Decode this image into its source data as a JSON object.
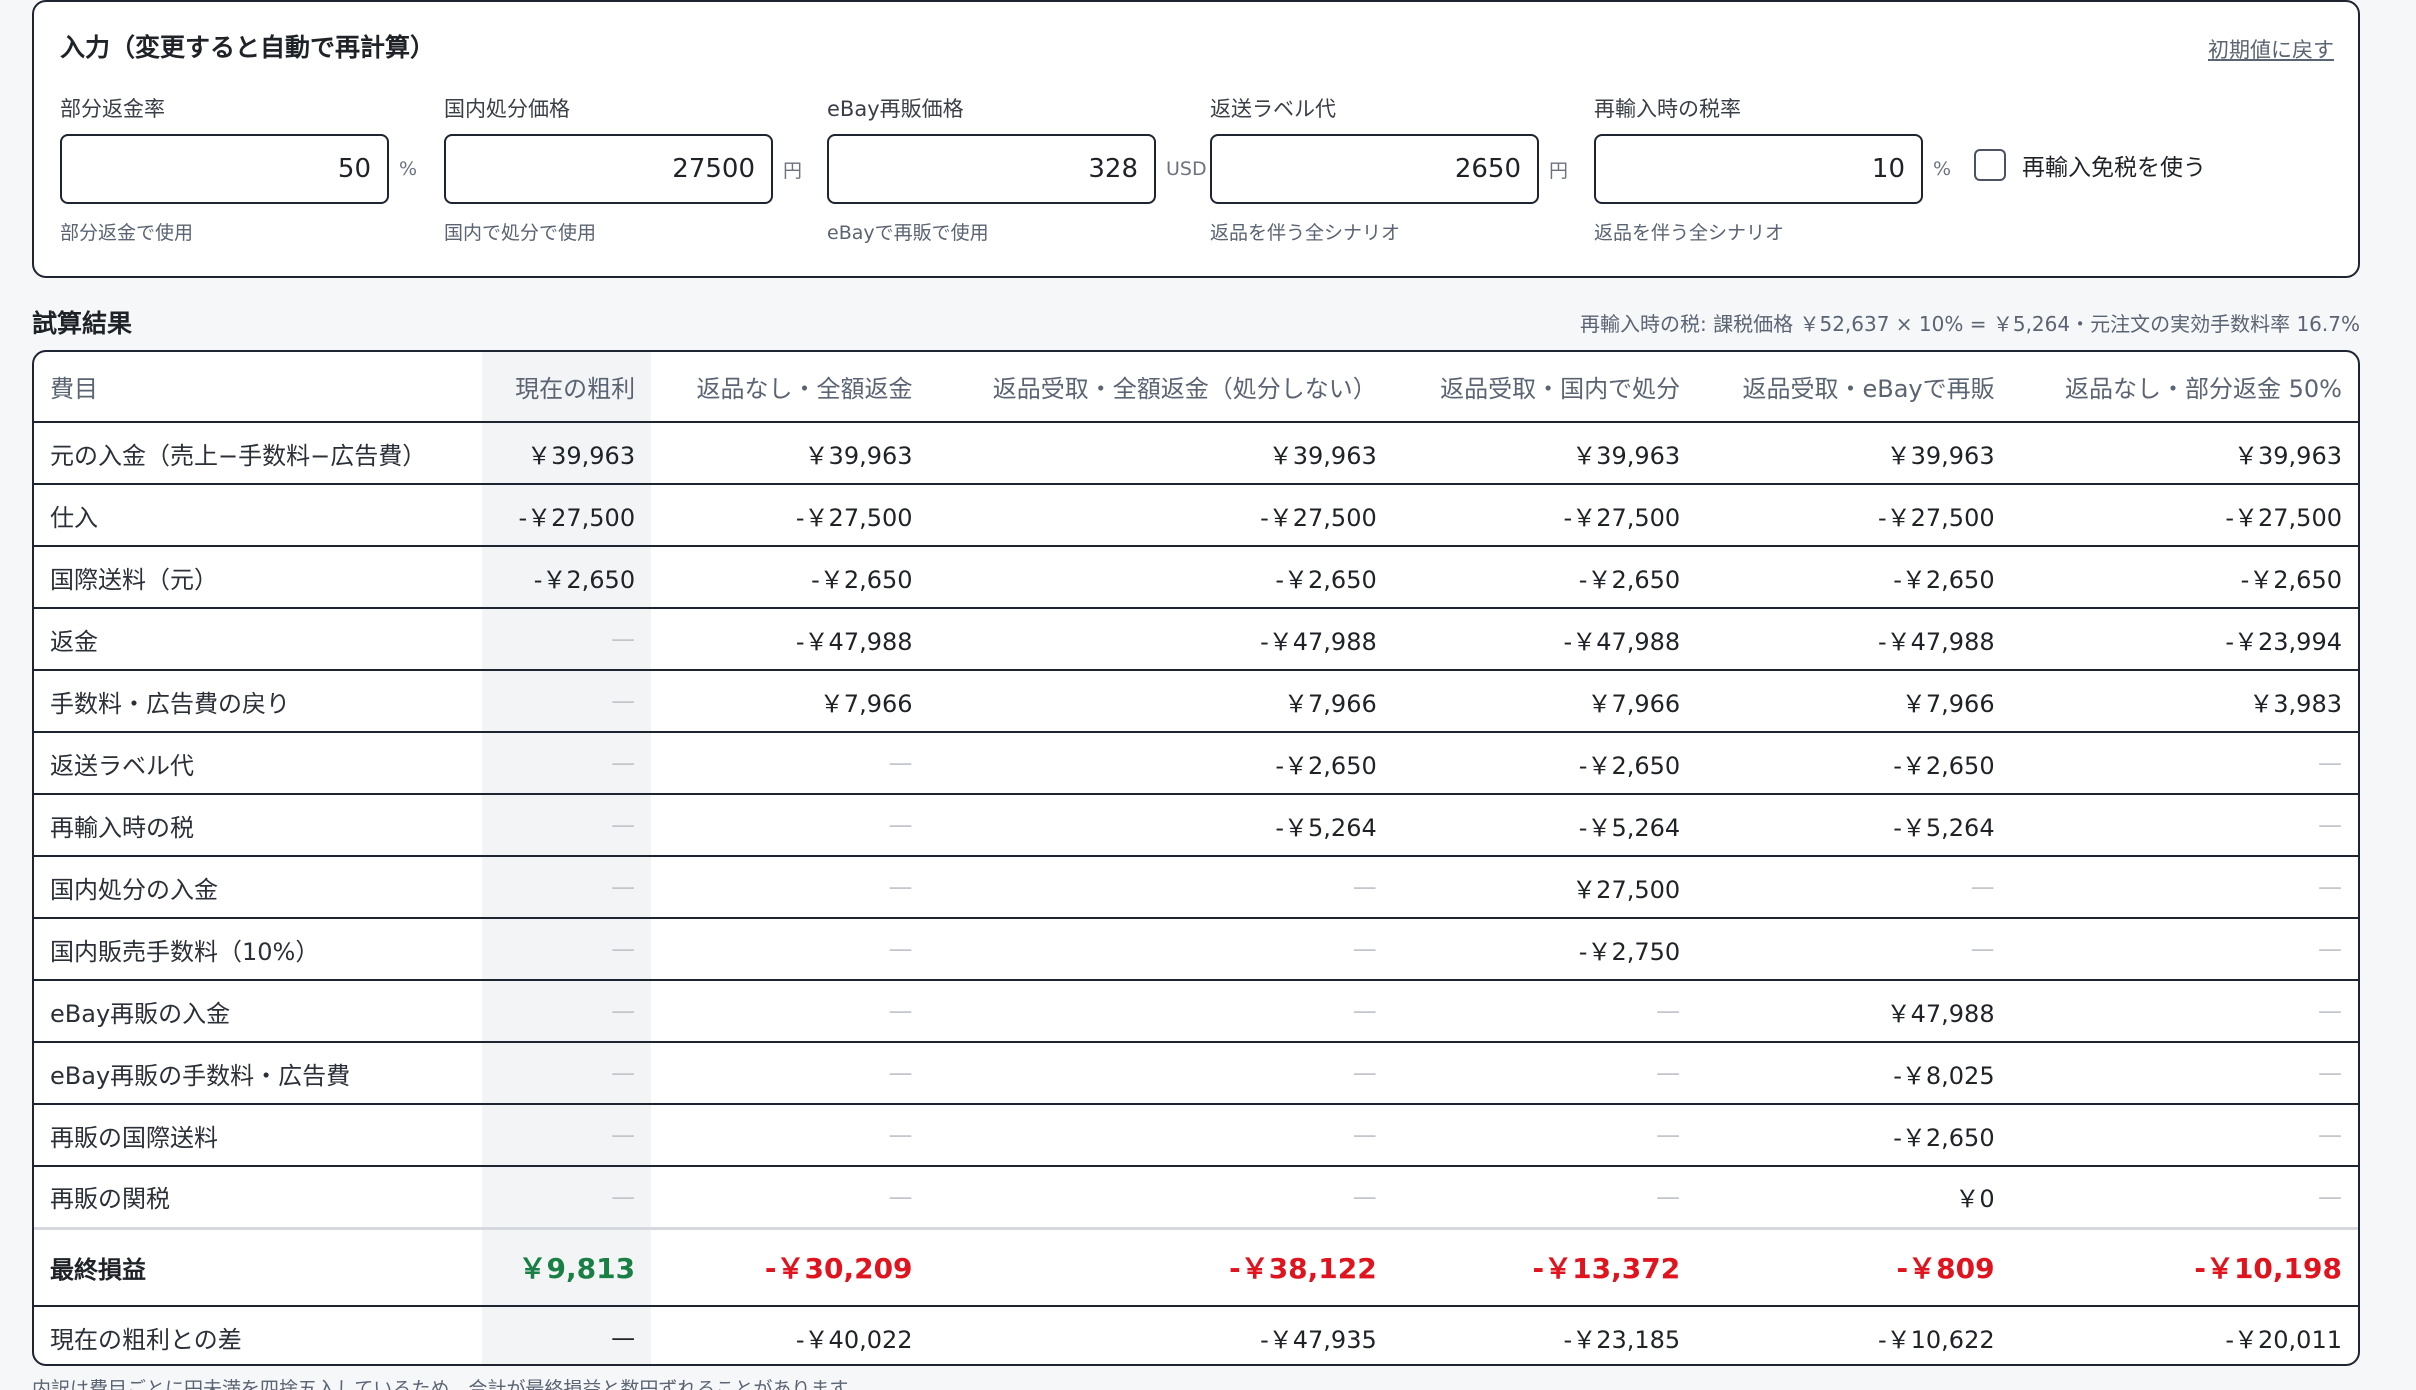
{
  "input_panel": {
    "title": "入力（変更すると自動で再計算）",
    "reset_label": "初期値に戻す",
    "fields": [
      {
        "label": "部分返金率",
        "value": "50",
        "unit": "%",
        "hint": "部分返金で使用"
      },
      {
        "label": "国内処分価格",
        "value": "27500",
        "unit": "円",
        "hint": "国内で処分で使用"
      },
      {
        "label": "eBay再販価格",
        "value": "328",
        "unit": "USD",
        "hint": "eBayで再販で使用"
      },
      {
        "label": "返送ラベル代",
        "value": "2650",
        "unit": "円",
        "hint": "返品を伴う全シナリオ"
      },
      {
        "label": "再輸入時の税率",
        "value": "10",
        "unit": "%",
        "hint": "返品を伴う全シナリオ"
      }
    ],
    "checkbox_label": "再輸入免税を使う",
    "checkbox_checked": false
  },
  "results": {
    "title": "試算結果",
    "note": "再輸入時の税: 課税価格 ￥52,637 × 10% = ￥5,264・元注文の実効手数料率 16.7%",
    "columns": [
      "費目",
      "現在の粗利",
      "返品なし・全額返金",
      "返品受取・全額返金（処分しない）",
      "返品受取・国内で処分",
      "返品受取・eBayで再販",
      "返品なし・部分返金 50%"
    ],
    "rows": [
      {
        "label": "元の入金（売上−手数料−広告費）",
        "cells": [
          "￥39,963",
          "￥39,963",
          "￥39,963",
          "￥39,963",
          "￥39,963",
          "￥39,963"
        ]
      },
      {
        "label": "仕入",
        "cells": [
          "-￥27,500",
          "-￥27,500",
          "-￥27,500",
          "-￥27,500",
          "-￥27,500",
          "-￥27,500"
        ]
      },
      {
        "label": "国際送料（元）",
        "cells": [
          "-￥2,650",
          "-￥2,650",
          "-￥2,650",
          "-￥2,650",
          "-￥2,650",
          "-￥2,650"
        ]
      },
      {
        "label": "返金",
        "cells": [
          "—",
          "-￥47,988",
          "-￥47,988",
          "-￥47,988",
          "-￥47,988",
          "-￥23,994"
        ]
      },
      {
        "label": "手数料・広告費の戻り",
        "cells": [
          "—",
          "￥7,966",
          "￥7,966",
          "￥7,966",
          "￥7,966",
          "￥3,983"
        ]
      },
      {
        "label": "返送ラベル代",
        "cells": [
          "—",
          "—",
          "-￥2,650",
          "-￥2,650",
          "-￥2,650",
          "—"
        ]
      },
      {
        "label": "再輸入時の税",
        "cells": [
          "—",
          "—",
          "-￥5,264",
          "-￥5,264",
          "-￥5,264",
          "—"
        ]
      },
      {
        "label": "国内処分の入金",
        "cells": [
          "—",
          "—",
          "—",
          "￥27,500",
          "—",
          "—"
        ]
      },
      {
        "label": "国内販売手数料（10%）",
        "cells": [
          "—",
          "—",
          "—",
          "-￥2,750",
          "—",
          "—"
        ]
      },
      {
        "label": "eBay再販の入金",
        "cells": [
          "—",
          "—",
          "—",
          "—",
          "￥47,988",
          "—"
        ]
      },
      {
        "label": "eBay再販の手数料・広告費",
        "cells": [
          "—",
          "—",
          "—",
          "—",
          "-￥8,025",
          "—"
        ]
      },
      {
        "label": "再販の国際送料",
        "cells": [
          "—",
          "—",
          "—",
          "—",
          "-￥2,650",
          "—"
        ]
      },
      {
        "label": "再販の関税",
        "cells": [
          "—",
          "—",
          "—",
          "—",
          "￥0",
          "—"
        ]
      }
    ],
    "total": {
      "label": "最終損益",
      "cells": [
        "￥9,813",
        "-￥30,209",
        "-￥38,122",
        "-￥13,372",
        "-￥809",
        "-￥10,198"
      ]
    },
    "diff": {
      "label": "現在の粗利との差",
      "cells": [
        "—",
        "-￥40,022",
        "-￥47,935",
        "-￥23,185",
        "-￥10,622",
        "-￥20,011"
      ]
    },
    "colors": {
      "profit": "#1a7f45",
      "loss": "#e0141e",
      "border": "#1e2430"
    }
  },
  "footnote": "内訳は費目ごとに円未満を四捨五入しているため、合計が最終損益と数円ずれることがあります。"
}
